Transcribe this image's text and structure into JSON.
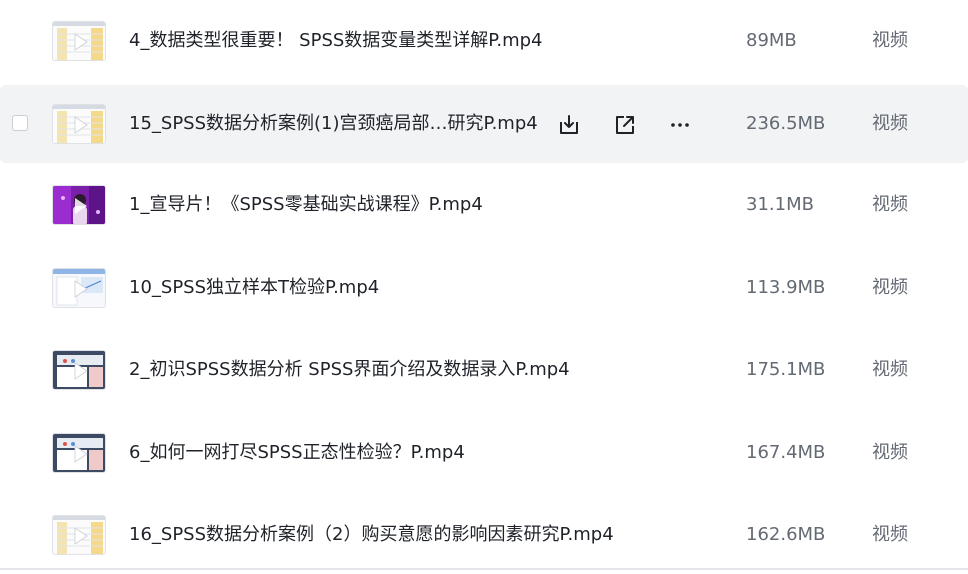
{
  "files": [
    {
      "name": "4_数据类型很重要！ SPSS数据变量类型详解P.mp4",
      "size": "89MB",
      "type": "视频",
      "thumb": "yellow"
    },
    {
      "name": "15_SPSS数据分析案例(1)宫颈癌局部…研究P.mp4",
      "size": "236.5MB",
      "type": "视频",
      "thumb": "yellow",
      "hovered": true
    },
    {
      "name": "1_宣导片！《SPSS零基础实战课程》P.mp4",
      "size": "31.1MB",
      "type": "视频",
      "thumb": "purple"
    },
    {
      "name": "10_SPSS独立样本T检验P.mp4",
      "size": "113.9MB",
      "type": "视频",
      "thumb": "blue"
    },
    {
      "name": "2_初识SPSS数据分析 SPSS界面介绍及数据录入P.mp4",
      "size": "175.1MB",
      "type": "视频",
      "thumb": "desktop"
    },
    {
      "name": "6_如何一网打尽SPSS正态性检验？P.mp4",
      "size": "167.4MB",
      "type": "视频",
      "thumb": "desktop"
    },
    {
      "name": "16_SPSS数据分析案例（2）购买意愿的影响因素研究P.mp4",
      "size": "162.6MB",
      "type": "视频",
      "thumb": "yellow"
    }
  ],
  "row_actions": {
    "download_icon": "download-icon",
    "share_icon": "share-icon",
    "more_icon": "more-icon"
  },
  "colors": {
    "hover_bg": "#f2f3f5",
    "secondary_text": "#646a73",
    "primary_text": "#1f2329"
  }
}
